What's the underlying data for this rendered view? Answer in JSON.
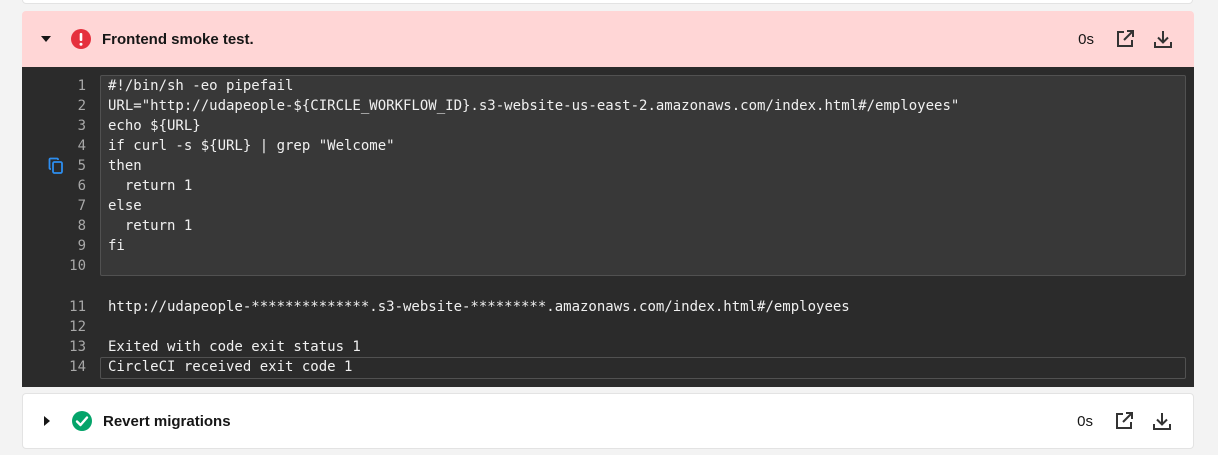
{
  "steps": [
    {
      "title": "Frontend smoke test.",
      "status": "failed",
      "status_icon": "error-icon",
      "duration": "0s",
      "expanded": true
    },
    {
      "title": "Revert migrations",
      "status": "success",
      "status_icon": "check-circle-icon",
      "duration": "0s",
      "expanded": false
    }
  ],
  "colors": {
    "failed_header_bg": "#ffd6d6",
    "error_red": "#e5303d",
    "success_green": "#04a46a",
    "console_bg": "#2b2b2b",
    "command_box_bg": "#383838",
    "copy_icon_blue": "#2d8ef0"
  },
  "console": {
    "command_lines": [
      {
        "n": "1",
        "text": "#!/bin/sh -eo pipefail"
      },
      {
        "n": "2",
        "text": "URL=\"http://udapeople-${CIRCLE_WORKFLOW_ID}.s3-website-us-east-2.amazonaws.com/index.html#/employees\""
      },
      {
        "n": "3",
        "text": "echo ${URL}"
      },
      {
        "n": "4",
        "text": "if curl -s ${URL} | grep \"Welcome\""
      },
      {
        "n": "5",
        "text": "then"
      },
      {
        "n": "6",
        "text": "  return 1"
      },
      {
        "n": "7",
        "text": "else"
      },
      {
        "n": "8",
        "text": "  return 1"
      },
      {
        "n": "9",
        "text": "fi"
      },
      {
        "n": "10",
        "text": ""
      }
    ],
    "output_lines": [
      {
        "n": "11",
        "text": "http://udapeople-**************.s3-website-*********.amazonaws.com/index.html#/employees"
      },
      {
        "n": "12",
        "text": ""
      },
      {
        "n": "13",
        "text": "Exited with code exit status 1"
      },
      {
        "n": "14",
        "text": "CircleCI received exit code 1"
      }
    ]
  }
}
